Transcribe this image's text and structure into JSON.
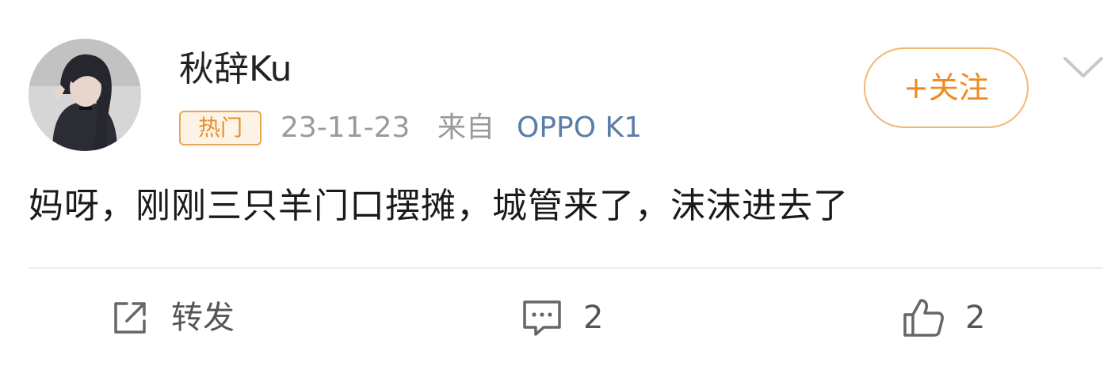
{
  "post": {
    "author": {
      "name": "秋辞Ku",
      "avatar_icon": "avatar-photo"
    },
    "badge": "热门",
    "date": "23-11-23",
    "source_prefix": "来自",
    "device": "OPPO K1",
    "follow_label": "+关注",
    "menu_icon": "chevron-down-icon",
    "content": "妈呀，刚刚三只羊门口摆摊，城管来了，沫沫进去了"
  },
  "actions": {
    "repost": {
      "icon": "repost-icon",
      "label": "转发"
    },
    "comment": {
      "icon": "comment-icon",
      "count": "2"
    },
    "like": {
      "icon": "like-icon",
      "count": "2"
    }
  },
  "colors": {
    "badge_border": "#e9a752",
    "badge_text": "#e7902a",
    "follow_accent": "#ee8a1f",
    "device_link": "#5b7ea8",
    "meta_gray": "#9a9a9a"
  }
}
